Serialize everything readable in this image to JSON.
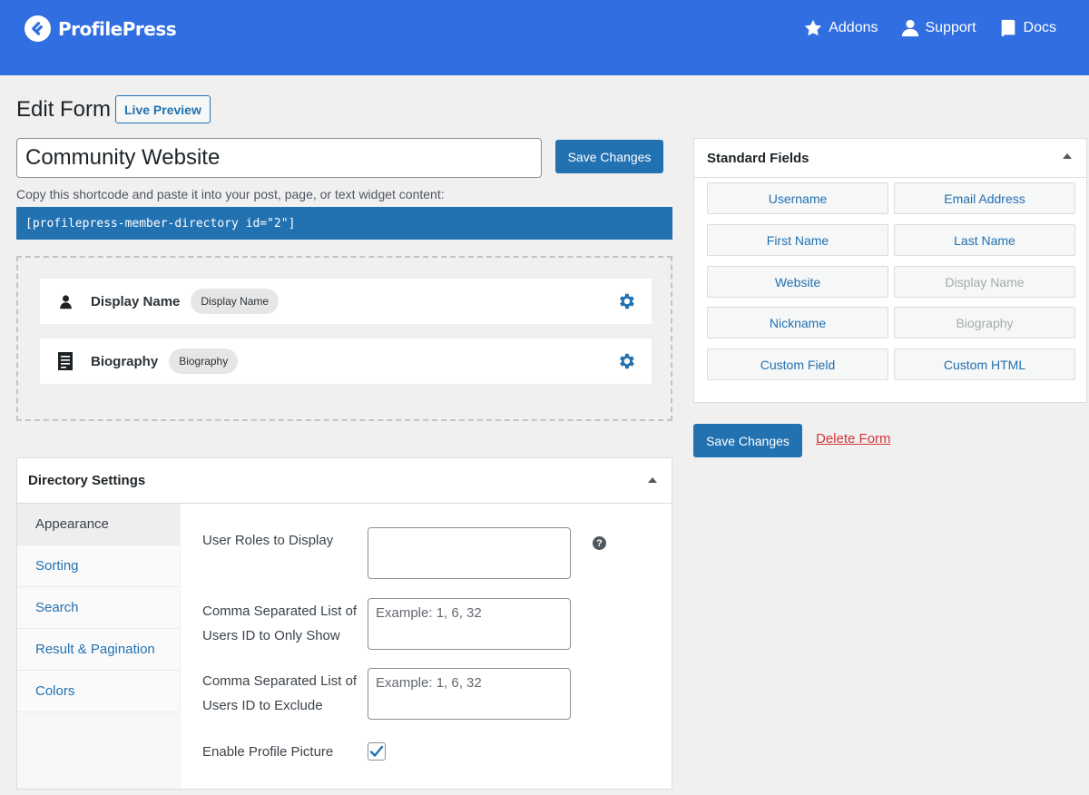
{
  "header": {
    "brand": "ProfilePress",
    "nav": [
      {
        "label": "Addons",
        "icon": "star-icon"
      },
      {
        "label": "Support",
        "icon": "user-icon"
      },
      {
        "label": "Docs",
        "icon": "book-icon"
      }
    ]
  },
  "page": {
    "title": "Edit Form",
    "live_preview": "Live Preview",
    "form_title_value": "Community Website",
    "save_label": "Save Changes",
    "shortcode_help": "Copy this shortcode and paste it into your post, page, or text widget content:",
    "shortcode": "[profilepress-member-directory id=\"2\"]"
  },
  "builder": {
    "fields": [
      {
        "name": "Display Name",
        "chip": "Display Name",
        "icon": "user-icon"
      },
      {
        "name": "Biography",
        "chip": "Biography",
        "icon": "document-icon"
      }
    ]
  },
  "directory": {
    "title": "Directory Settings",
    "tabs": [
      "Appearance",
      "Sorting",
      "Search",
      "Result & Pagination",
      "Colors"
    ],
    "settings": {
      "roles_label": "User Roles to Display",
      "only_show_label": "Comma Separated List of Users ID to Only Show",
      "only_show_placeholder": "Example: 1, 6, 32",
      "exclude_label": "Comma Separated List of Users ID to Exclude",
      "exclude_placeholder": "Example: 1, 6, 32",
      "profile_picture_label": "Enable Profile Picture",
      "profile_picture_checked": true,
      "help_glyph": "?"
    }
  },
  "standard_fields": {
    "title": "Standard Fields",
    "buttons": [
      {
        "label": "Username",
        "enabled": true
      },
      {
        "label": "Email Address",
        "enabled": true
      },
      {
        "label": "First Name",
        "enabled": true
      },
      {
        "label": "Last Name",
        "enabled": true
      },
      {
        "label": "Website",
        "enabled": true
      },
      {
        "label": "Display Name",
        "enabled": false
      },
      {
        "label": "Nickname",
        "enabled": true
      },
      {
        "label": "Biography",
        "enabled": false
      },
      {
        "label": "Custom Field",
        "enabled": true
      },
      {
        "label": "Custom HTML",
        "enabled": true
      }
    ]
  },
  "actions": {
    "save_label": "Save Changes",
    "delete_label": "Delete Form"
  },
  "colors": {
    "brand": "#306ee1",
    "primary": "#2271b1",
    "danger": "#d63638"
  }
}
